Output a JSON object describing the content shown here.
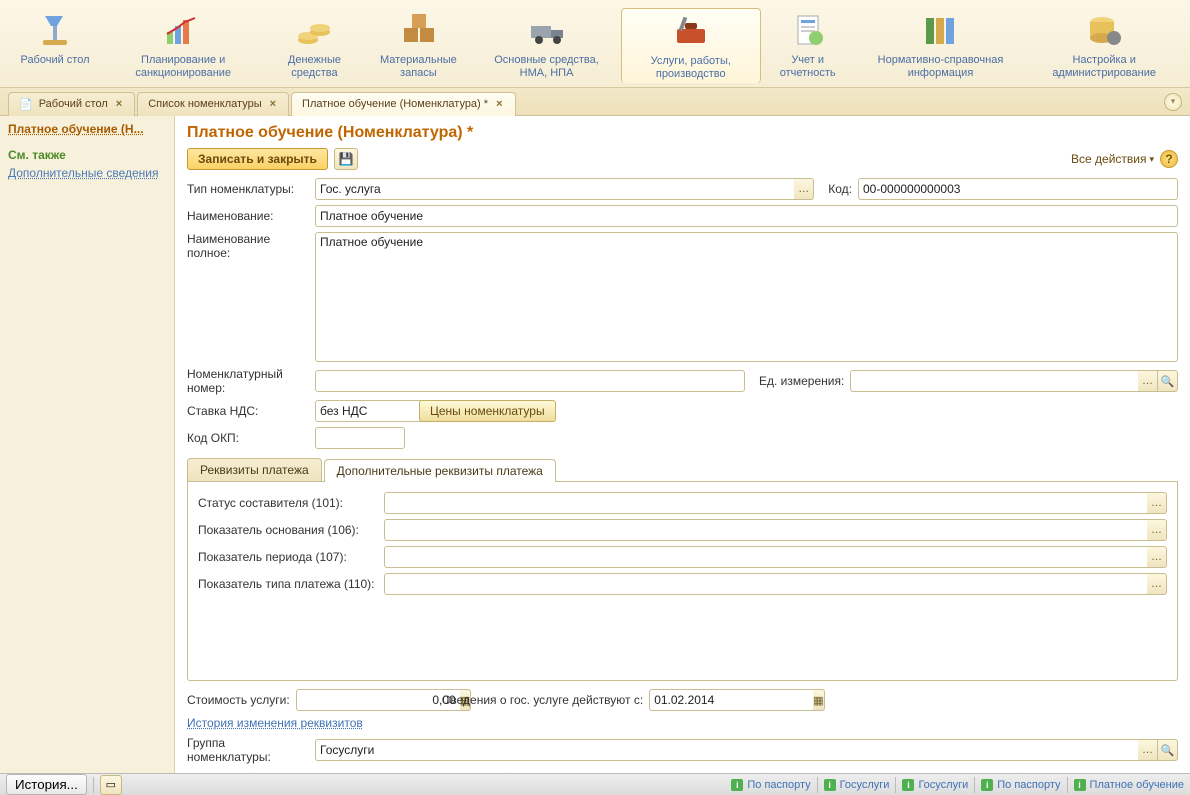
{
  "toolbar": [
    {
      "label": "Рабочий стол"
    },
    {
      "label": "Планирование и санкционирование"
    },
    {
      "label": "Денежные средства"
    },
    {
      "label": "Материальные запасы"
    },
    {
      "label": "Основные средства, НМА, НПА"
    },
    {
      "label": "Услуги, работы, производство"
    },
    {
      "label": "Учет и отчетность"
    },
    {
      "label": "Нормативно-справочная информация"
    },
    {
      "label": "Настройка и администрирование"
    }
  ],
  "tabs": {
    "t0": "Рабочий стол",
    "t1": "Список номенклатуры",
    "t2": "Платное обучение (Номенклатура) *"
  },
  "leftnav": {
    "title": "Платное обучение (Н...",
    "section": "См. также",
    "link1": "Дополнительные сведения"
  },
  "form": {
    "title": "Платное обучение (Номенклатура) *",
    "save_close": "Записать и закрыть",
    "all_actions": "Все действия",
    "labels": {
      "type": "Тип номенклатуры:",
      "code": "Код:",
      "name": "Наименование:",
      "fullname": "Наименование полное:",
      "nomnumber": "Номенклатурный номер:",
      "unit": "Ед. измерения:",
      "vat": "Ставка НДС:",
      "prices_btn": "Цены номенклатуры",
      "okp": "Код ОКП:",
      "tab_req": "Реквизиты платежа",
      "tab_addreq": "Дополнительные реквизиты платежа",
      "f101": "Статус составителя (101):",
      "f106": "Показатель основания (106):",
      "f107": "Показатель периода (107):",
      "f110": "Показатель типа платежа (110):",
      "cost": "Стоимость услуги:",
      "valid_from": "Сведения о гос. услуге действуют с:",
      "history": "История изменения реквизитов",
      "group": "Группа номенклатуры:"
    },
    "values": {
      "type": "Гос. услуга",
      "code": "00-000000000003",
      "name": "Платное обучение",
      "fullname": "Платное обучение",
      "nomnumber": "",
      "unit": "",
      "vat": "без НДС",
      "okp": "",
      "f101": "",
      "f106": "",
      "f107": "",
      "f110": "",
      "cost": "0,00",
      "valid_from": "01.02.2014",
      "group": "Госуслуги"
    }
  },
  "statusbar": {
    "history": "История...",
    "links": [
      "По паспорту",
      "Госуслуги",
      "Госуслуги",
      "По паспорту",
      "Платное обучение"
    ]
  }
}
